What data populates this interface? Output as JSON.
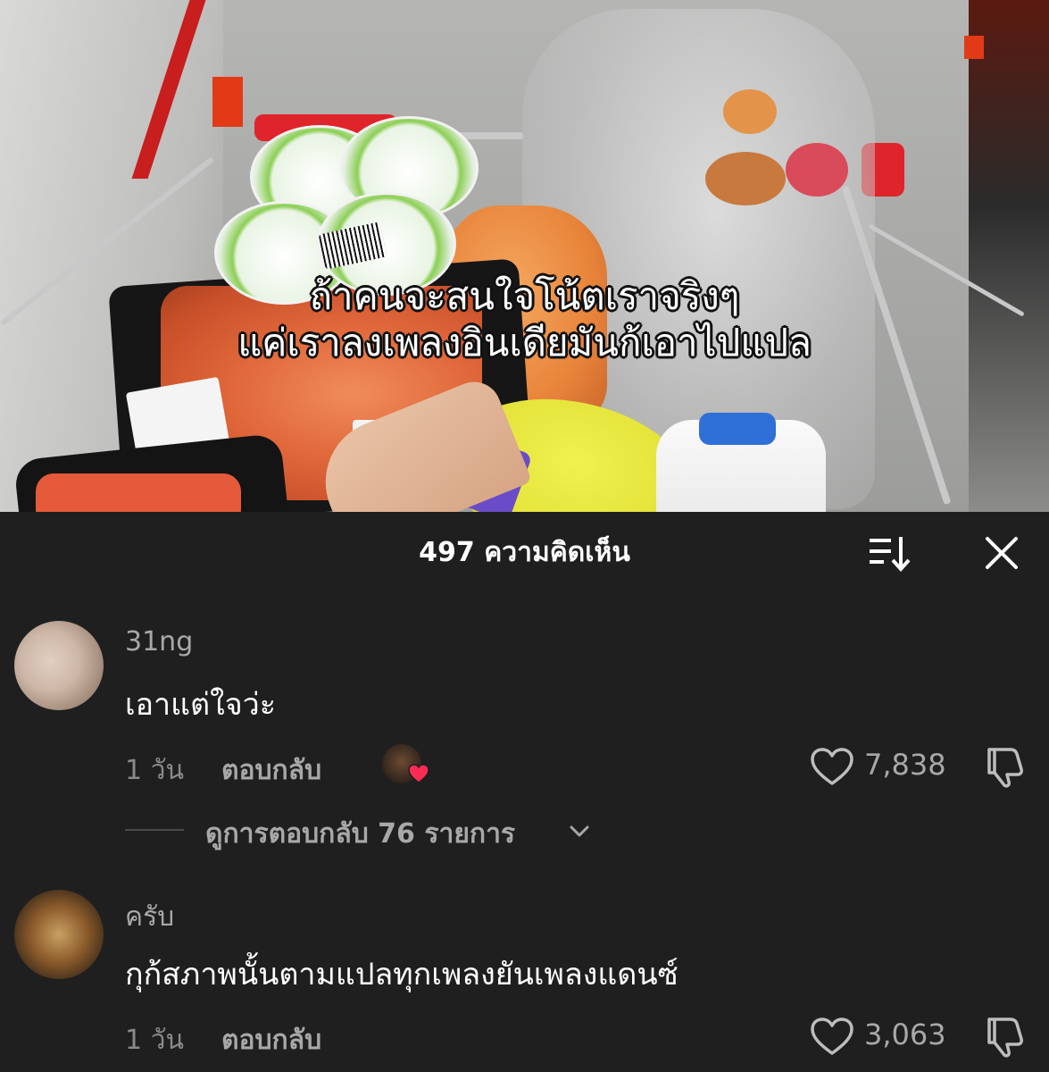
{
  "video": {
    "caption_lines": [
      "ถ้าคนจะสนใจโน้ตเราจริงๆ",
      "แค่เราลงเพลงอินเดียมันก้เอาไปแปล"
    ]
  },
  "comments_panel": {
    "title": "497 ความคิดเห็น",
    "sort_icon": "sort-icon",
    "close_icon": "close-icon",
    "comments": [
      {
        "username": "31ng",
        "text": "เอาแต่ใจว่ะ",
        "time": "1 วัน",
        "reply_label": "ตอบกลับ",
        "liked_by_creator": true,
        "like_count": "7,838",
        "view_replies": "ดูการตอบกลับ 76 รายการ"
      },
      {
        "username": "ครับ",
        "text": "กุก้สภาพนั้นตามแปลทุกเพลงยันเพลงแดนซ์",
        "time": "1 วัน",
        "reply_label": "ตอบกลับ",
        "liked_by_creator": false,
        "like_count": "3,063"
      }
    ]
  },
  "colors": {
    "panel_bg": "#1f1f1f",
    "heart_badge": "#fe2c55",
    "secondary_text": "#a8a8a8"
  }
}
